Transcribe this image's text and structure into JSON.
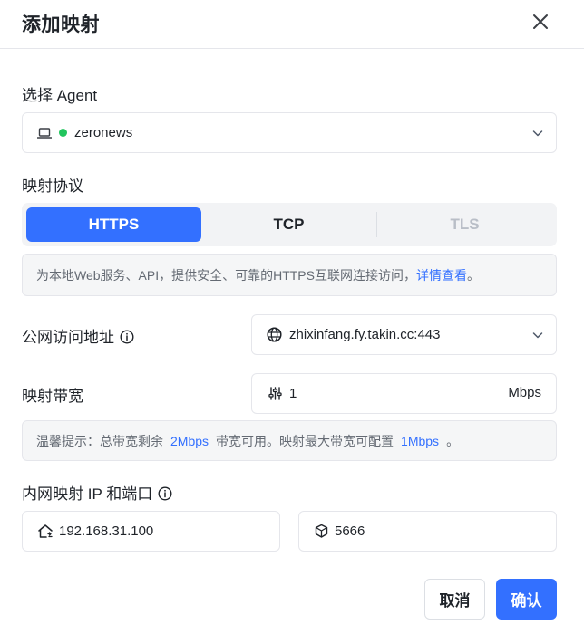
{
  "dialog": {
    "title": "添加映射"
  },
  "agent": {
    "label": "选择 Agent",
    "selected": "zeronews",
    "status_color": "#22c55e"
  },
  "protocol": {
    "label": "映射协议",
    "options": [
      {
        "label": "HTTPS",
        "state": "active"
      },
      {
        "label": "TCP",
        "state": "normal"
      },
      {
        "label": "TLS",
        "state": "disabled"
      }
    ],
    "description": "为本地Web服务、API，提供安全、可靠的HTTPS互联网连接访问，",
    "description_link": "详情查看",
    "description_end": "。"
  },
  "public_address": {
    "label": "公网访问地址",
    "value": "zhixinfang.fy.takin.cc:443"
  },
  "bandwidth": {
    "label": "映射带宽",
    "value": "1",
    "unit": "Mbps",
    "hint_prefix": "温馨提示：总带宽剩余",
    "hint_remaining": "2Mbps",
    "hint_middle": "带宽可用。映射最大带宽可配置",
    "hint_max": "1Mbps",
    "hint_suffix": "。"
  },
  "internal": {
    "label": "内网映射 IP 和端口",
    "ip": "192.168.31.100",
    "port": "5666"
  },
  "footer": {
    "cancel_label": "取消",
    "confirm_label": "确认"
  },
  "colors": {
    "accent": "#3370ff",
    "text": "#1f2329",
    "muted": "#646a73"
  }
}
